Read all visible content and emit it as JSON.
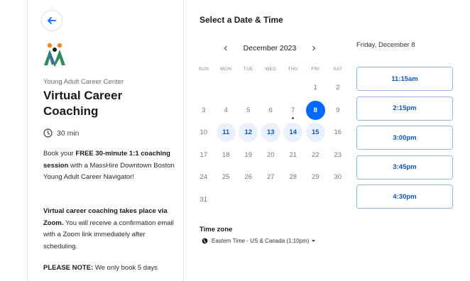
{
  "event": {
    "org_name": "Young Adult Career Center",
    "title": "Virtual Career Coaching",
    "duration": "30 min",
    "description": [
      {
        "type": "mixed",
        "parts": [
          "Book your ",
          {
            "bold": "FREE 30-minute 1:1 coaching session"
          },
          " with a MassHire Downtown Boston Young Adult Career Navigator!"
        ]
      },
      {
        "type": "mixed",
        "parts": [
          {
            "bold": "Virtual career coaching takes place via Zoom."
          },
          " You will receive a confirmation email with a Zoom link immediately after scheduling."
        ]
      },
      {
        "type": "mixed",
        "parts": [
          {
            "bold": "PLEASE NOTE:"
          },
          " We only book 5 days"
        ]
      }
    ]
  },
  "scheduler": {
    "title": "Select a Date & Time",
    "month_label": "December 2023",
    "weekdays": [
      "SUN",
      "MON",
      "TUE",
      "WED",
      "THU",
      "FRI",
      "SAT"
    ],
    "days": [
      {
        "n": "",
        "state": "empty"
      },
      {
        "n": "",
        "state": "empty"
      },
      {
        "n": "",
        "state": "empty"
      },
      {
        "n": "",
        "state": "empty"
      },
      {
        "n": "",
        "state": "empty"
      },
      {
        "n": "1",
        "state": "off"
      },
      {
        "n": "2",
        "state": "off"
      },
      {
        "n": "3",
        "state": "off"
      },
      {
        "n": "4",
        "state": "off"
      },
      {
        "n": "5",
        "state": "off"
      },
      {
        "n": "6",
        "state": "off"
      },
      {
        "n": "7",
        "state": "off",
        "today": true
      },
      {
        "n": "8",
        "state": "sel"
      },
      {
        "n": "9",
        "state": "off"
      },
      {
        "n": "10",
        "state": "off"
      },
      {
        "n": "11",
        "state": "avail"
      },
      {
        "n": "12",
        "state": "avail"
      },
      {
        "n": "13",
        "state": "avail"
      },
      {
        "n": "14",
        "state": "avail"
      },
      {
        "n": "15",
        "state": "avail"
      },
      {
        "n": "16",
        "state": "off"
      },
      {
        "n": "17",
        "state": "off"
      },
      {
        "n": "18",
        "state": "off"
      },
      {
        "n": "19",
        "state": "off"
      },
      {
        "n": "20",
        "state": "off"
      },
      {
        "n": "21",
        "state": "off"
      },
      {
        "n": "22",
        "state": "off"
      },
      {
        "n": "23",
        "state": "off"
      },
      {
        "n": "24",
        "state": "off"
      },
      {
        "n": "25",
        "state": "off"
      },
      {
        "n": "26",
        "state": "off"
      },
      {
        "n": "27",
        "state": "off"
      },
      {
        "n": "28",
        "state": "off"
      },
      {
        "n": "29",
        "state": "off"
      },
      {
        "n": "30",
        "state": "off"
      },
      {
        "n": "31",
        "state": "off"
      }
    ],
    "timezone_label": "Time zone",
    "timezone_value": "Eastern Time - US & Canada (1:10pm)",
    "selected_date": "Friday, December 8",
    "slots": [
      "11:15am",
      "2:15pm",
      "3:00pm",
      "3:45pm",
      "4:30pm"
    ]
  },
  "colors": {
    "accent": "#0069ff",
    "available_bg": "#e9f1fe",
    "slot_border": "#8fb6f2"
  },
  "icons": {
    "back": "arrow-left-icon",
    "duration": "clock-icon",
    "timezone": "globe-icon",
    "prev": "chevron-left-icon",
    "next": "chevron-right-icon"
  }
}
